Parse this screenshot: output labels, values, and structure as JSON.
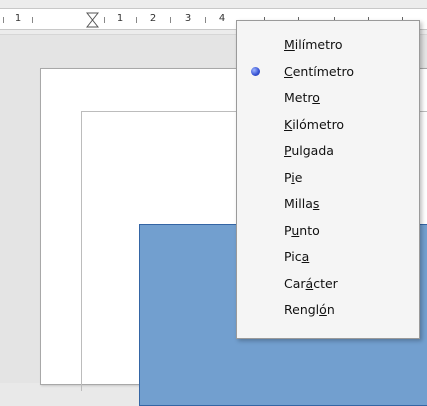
{
  "ruler": {
    "numbers": [
      "1",
      "1",
      "2",
      "3",
      "4"
    ]
  },
  "unit_menu": {
    "selected": "Centímetro",
    "items": [
      {
        "pre": "",
        "key": "M",
        "post": "ilímetro",
        "selected": false
      },
      {
        "pre": "",
        "key": "C",
        "post": "entímetro",
        "selected": true
      },
      {
        "pre": "Metr",
        "key": "o",
        "post": "",
        "selected": false
      },
      {
        "pre": "",
        "key": "K",
        "post": "ilómetro",
        "selected": false
      },
      {
        "pre": "",
        "key": "P",
        "post": "ulgada",
        "selected": false
      },
      {
        "pre": "P",
        "key": "i",
        "post": "e",
        "selected": false
      },
      {
        "pre": "Milla",
        "key": "s",
        "post": "",
        "selected": false
      },
      {
        "pre": "P",
        "key": "u",
        "post": "nto",
        "selected": false
      },
      {
        "pre": "Pic",
        "key": "a",
        "post": "",
        "selected": false
      },
      {
        "pre": "Car",
        "key": "á",
        "post": "cter",
        "selected": false
      },
      {
        "pre": "Rengl",
        "key": "ó",
        "post": "n",
        "selected": false
      }
    ]
  },
  "colors": {
    "shape_fill": "#729fcf",
    "shape_border": "#3465a4",
    "radio": "#3b57d6"
  }
}
